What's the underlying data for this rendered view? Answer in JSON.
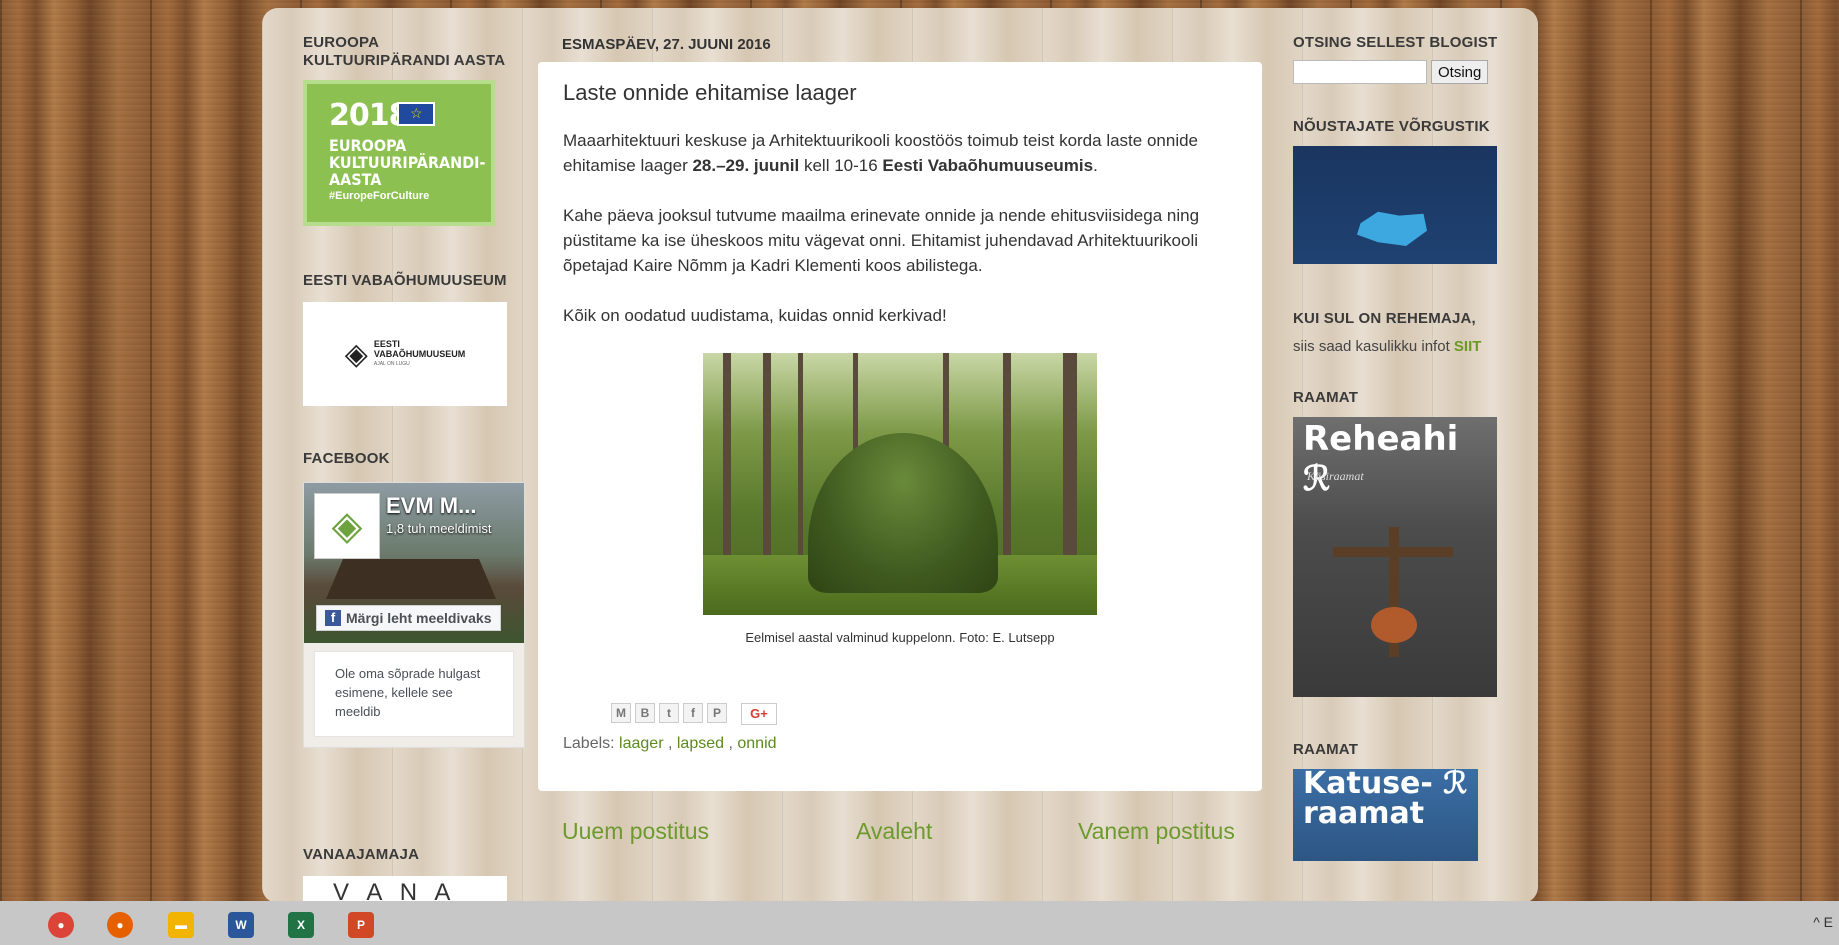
{
  "left_sidebar": {
    "eu_title": "EUROOPA KULTUURIPÄRANDI AASTA",
    "eu_banner": {
      "year": "2018",
      "line1": "EUROOPA",
      "line2": "KULTUURIPÄRANDI-",
      "line3": "AASTA",
      "hashtag": "#EuropeForCulture"
    },
    "evm_title": "EESTI VABAÕHUMUUSEUM",
    "evm_logo_line1": "EESTI",
    "evm_logo_line2": "VABAÕHUMUUSEUM",
    "evm_logo_line3": "AJAL ON LUGU",
    "facebook_title": "FACEBOOK",
    "facebook": {
      "page_name": "EVM M...",
      "likes": "1,8 tuh meeldimist",
      "like_button": "Märgi leht meeldivaks",
      "friends_text": "Ole oma sõprade hulgast esimene, kellele see meeldib"
    },
    "vanaajamaja_title": "VANAAJAMAJA",
    "vanaajamaja_thumb_text": "V A N A"
  },
  "post": {
    "date": "ESMASPÄEV, 27. JUUNI 2016",
    "title": "Laste onnide ehitamise laager",
    "p1_a": "Maaarhitektuuri keskuse ja Arhitektuurikooli koostöös toimub teist korda laste onnide ehitamise laager ",
    "p1_b": "28.–29. juunil",
    "p1_c": " kell 10-16 ",
    "p1_d": "Eesti Vabaõhumuuseumis",
    "p1_e": ".",
    "p2": "Kahe päeva jooksul tutvume maailma erinevate onnide ja nende ehitusviisidega ning püstitame ka ise üheskoos mitu vägevat onni. Ehitamist juhendavad Arhitektuurikooli õpetajad Kaire Nõmm ja Kadri Klementi koos abilistega.",
    "p3": "Kõik on oodatud uudistama, kuidas onnid kerkivad!",
    "caption": "Eelmisel aastal valminud kuppelonn. Foto: E. Lutsepp",
    "share": {
      "email": "M",
      "blog": "B",
      "twitter": "t",
      "facebook": "f",
      "pinterest": "P",
      "gplus": "G+"
    },
    "labels_prefix": "Labels: ",
    "labels": [
      "laager",
      "lapsed",
      "onnid"
    ],
    "sep1": " , ",
    "sep2": " , "
  },
  "pager": {
    "newer": "Uuem postitus",
    "home": "Avaleht",
    "older": "Vanem postitus"
  },
  "right_sidebar": {
    "search_title": "OTSING SELLEST BLOGIST",
    "search_button": "Otsing",
    "search_value": "",
    "network_title": "NÕUSTAJATE VÕRGUSTIK",
    "rehemaja_title": "KUI SUL ON REHEMAJA,",
    "rehemaja_text": "siis saad kasulikku infot ",
    "rehemaja_link": "SIIT",
    "book1_title": "RAAMAT",
    "book1_cover_title": "Reheahi",
    "book1_cover_sub": "Käsiraamat",
    "book2_title": "RAAMAT",
    "book2_cover_line1": "Katuse-",
    "book2_cover_line2": "raamat",
    "book_logo": "ℛ"
  },
  "taskbar": {
    "apps": [
      {
        "name": "chrome",
        "label": "●",
        "color": "#db4437"
      },
      {
        "name": "firefox",
        "label": "●",
        "color": "#e66000"
      },
      {
        "name": "files",
        "label": "▬",
        "color": "#f3b400"
      },
      {
        "name": "word",
        "label": "W",
        "color": "#2b579a"
      },
      {
        "name": "excel",
        "label": "X",
        "color": "#217346"
      },
      {
        "name": "powerpoint",
        "label": "P",
        "color": "#d24726"
      }
    ],
    "tray_chevron": "^",
    "tray_text": "E"
  }
}
